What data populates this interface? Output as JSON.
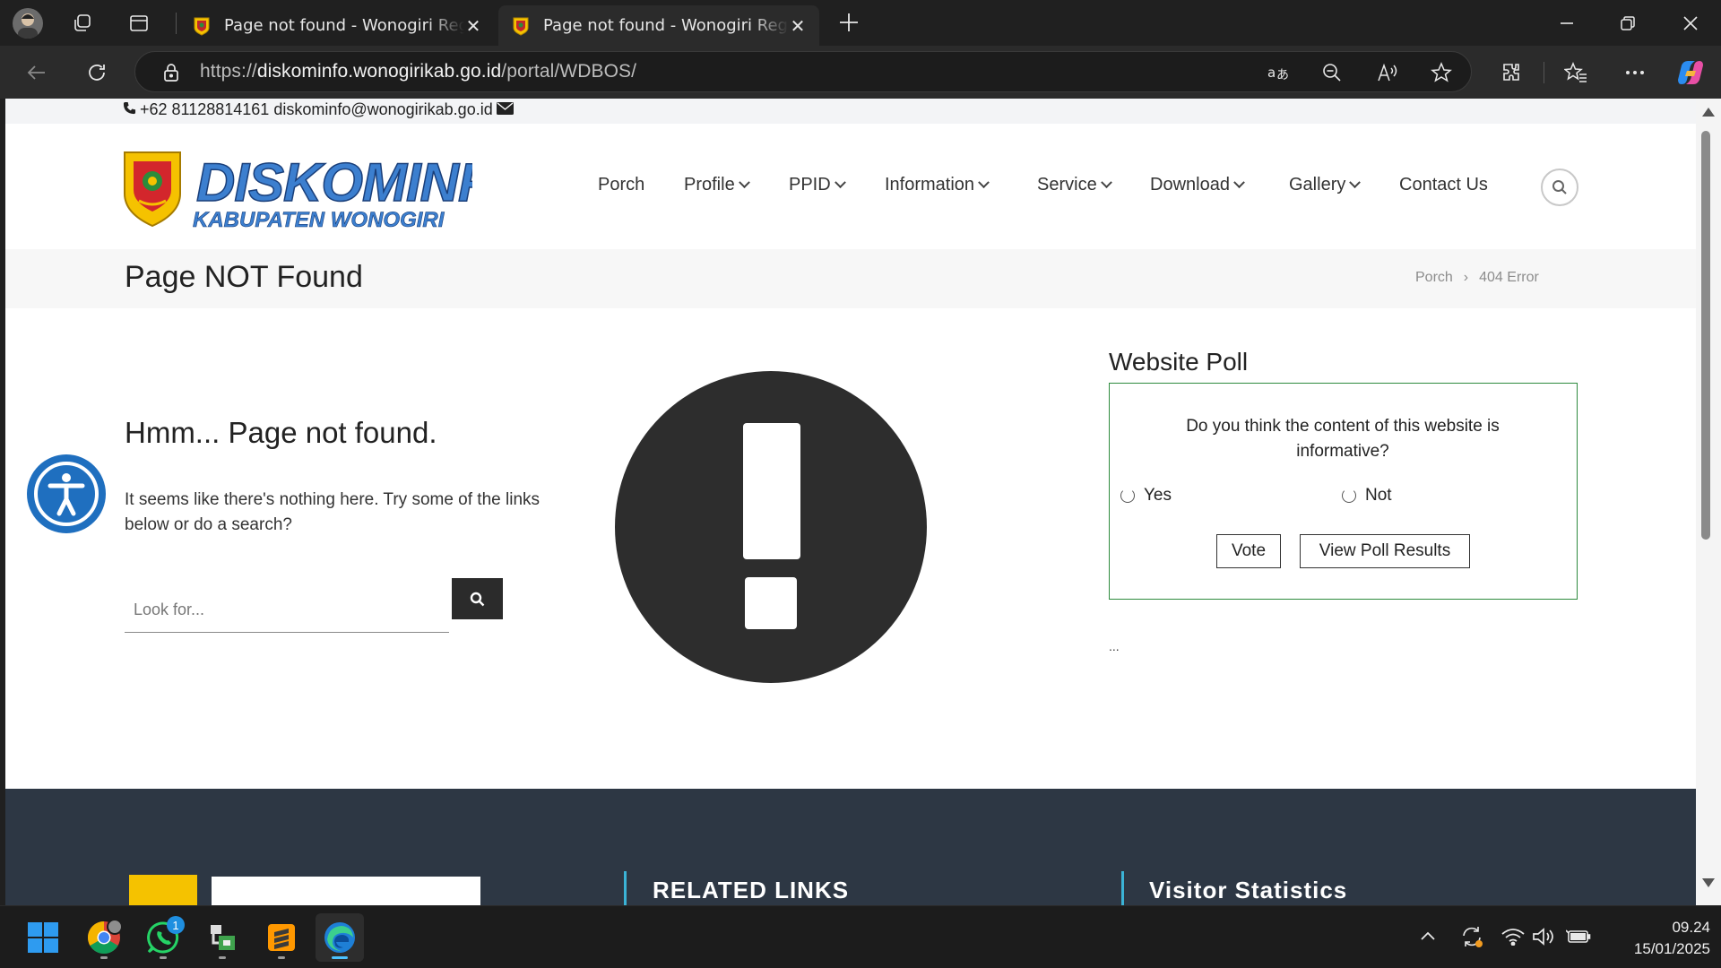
{
  "browser": {
    "tabs": [
      {
        "title": "Page not found - Wonogiri Regency",
        "active": false
      },
      {
        "title": "Page not found - Wonogiri Regency",
        "active": true
      }
    ],
    "url_prefix": "https://",
    "url_host": "diskominfo.wonogirikab.go.id",
    "url_path": "/portal/WDBOS/"
  },
  "site": {
    "contact_text": "+62 81128814161 diskominfo@wonogirikab.go.id",
    "logo_line1": "DISKOMINFO",
    "logo_line2": "KABUPATEN WONOGIRI",
    "nav": [
      {
        "label": "Porch",
        "dropdown": false
      },
      {
        "label": "Profile",
        "dropdown": true
      },
      {
        "label": "PPID",
        "dropdown": true
      },
      {
        "label": "Information",
        "dropdown": true
      },
      {
        "label": "Service",
        "dropdown": true
      },
      {
        "label": "Download",
        "dropdown": true
      },
      {
        "label": "Gallery",
        "dropdown": true
      },
      {
        "label": "Contact Us",
        "dropdown": false
      }
    ],
    "page_title": "Page NOT Found",
    "breadcrumb": {
      "home": "Porch",
      "separator": "›",
      "current": "404 Error"
    }
  },
  "not_found": {
    "heading": "Hmm... Page not found.",
    "text": "It seems like there's nothing here. Try some of the links below or do a search?",
    "search_placeholder": "Look for..."
  },
  "poll": {
    "heading": "Website Poll",
    "question": "Do you think the content of this website is informative?",
    "options": [
      "Yes",
      "Not"
    ],
    "vote_label": "Vote",
    "results_label": "View Poll Results",
    "more": "..."
  },
  "footer": {
    "headings": [
      "RELATED LINKS",
      "Visitor Statistics"
    ]
  },
  "taskbar": {
    "whatsapp_badge": "1",
    "time": "09.24",
    "date": "15/01/2025"
  },
  "colors": {
    "accent_blue": "#1f6fbf",
    "poll_border": "#2e8b3e",
    "footer_bg": "#2d3744",
    "footer_accent": "#3bb3d6"
  }
}
